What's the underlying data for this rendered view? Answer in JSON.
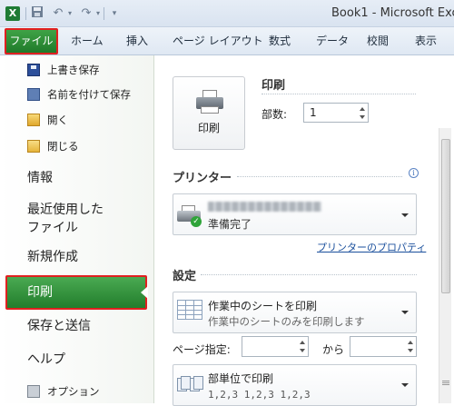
{
  "titlebar": {
    "logo": "X",
    "title": "Book1 - Microsoft Exce",
    "icons": [
      "save-icon",
      "undo-icon",
      "redo-icon",
      "customize-qat-icon"
    ]
  },
  "ribbon": {
    "tabs": [
      "ファイル",
      "ホーム",
      "挿入",
      "ページ レイアウト",
      "数式",
      "データ",
      "校閲",
      "表示"
    ]
  },
  "backstage": {
    "commands": [
      "上書き保存",
      "名前を付けて保存",
      "開く",
      "閉じる"
    ],
    "info": "情報",
    "recent_line1": "最近使用した",
    "recent_line2": "ファイル",
    "new": "新規作成",
    "print": "印刷",
    "save_send": "保存と送信",
    "help": "ヘルプ",
    "options": "オプション"
  },
  "print_panel": {
    "title": "印刷",
    "print_button": "印刷",
    "copies_label": "部数:",
    "copies_value": "1",
    "printer_title": "プリンター",
    "printer_status": "準備完了",
    "printer_properties": "プリンターのプロパティ",
    "settings_title": "設定",
    "scope_main": "作業中のシートを印刷",
    "scope_sub": "作業中のシートのみを印刷します",
    "pages_label": "ページ指定:",
    "pages_from": "",
    "pages_to_label": "から",
    "pages_to": "",
    "collate_main": "部単位で印刷",
    "collate_sub": "1,2,3   1,2,3   1,2,3"
  },
  "colors": {
    "file_tab": "#2c8f36",
    "highlight_border": "#e02020",
    "link": "#1a4f9c"
  }
}
